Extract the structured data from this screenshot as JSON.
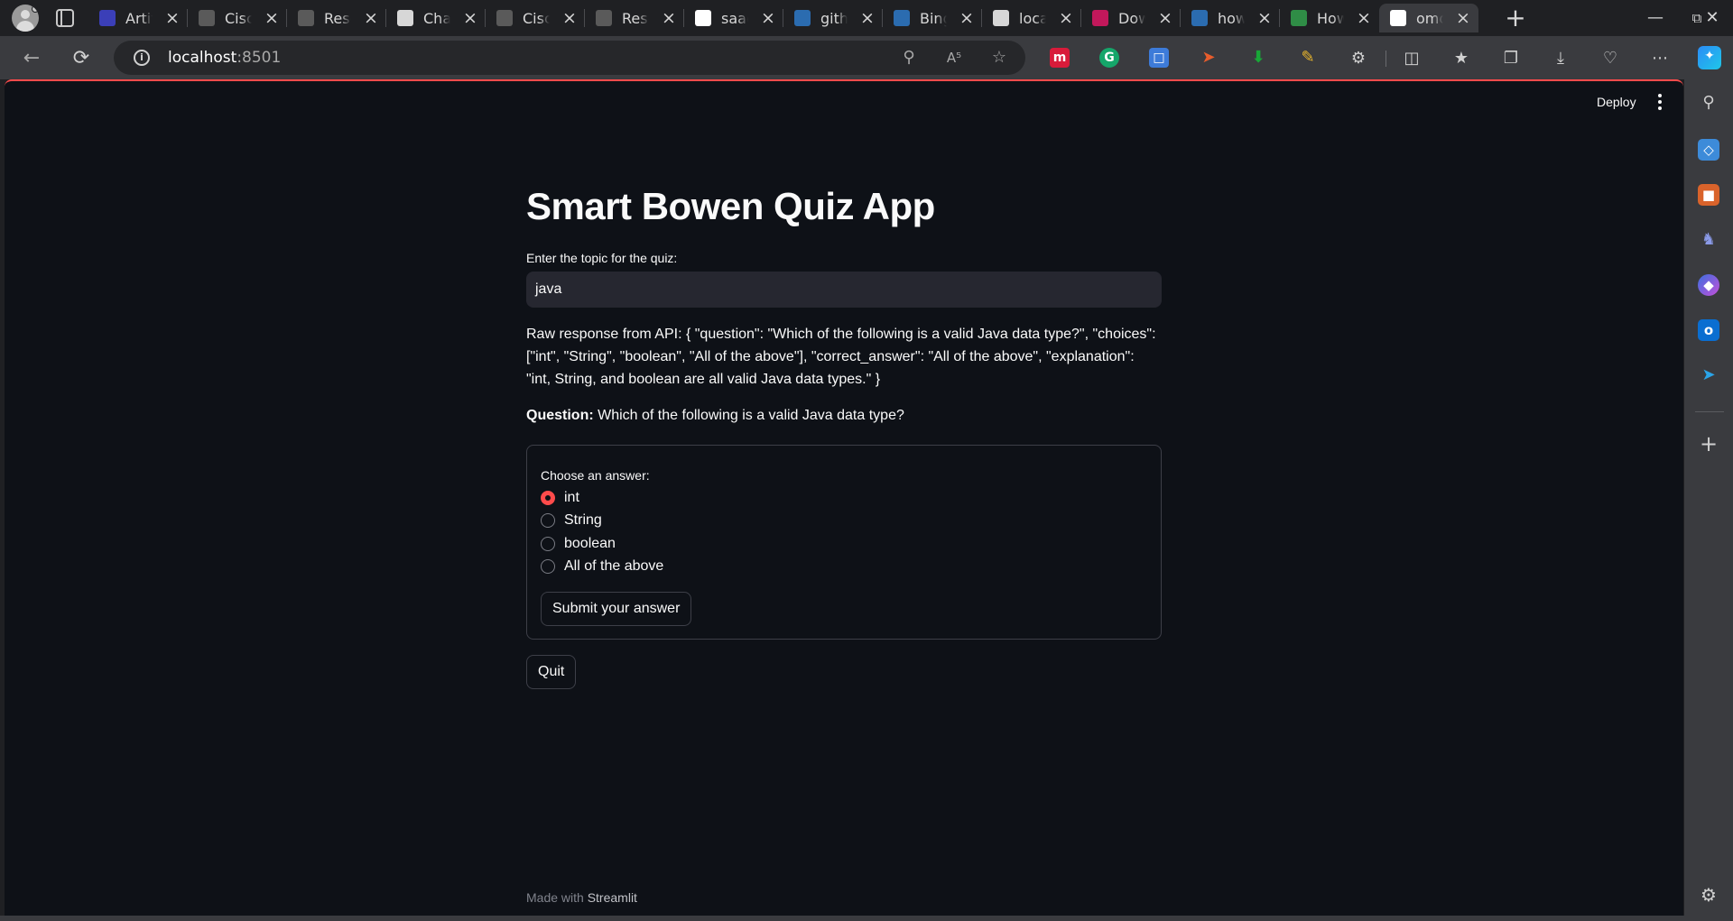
{
  "browser": {
    "tabs": [
      {
        "title": "Artifacts",
        "favicon": "artifacts-icon",
        "color": "#3b3fb8"
      },
      {
        "title": "Cisco",
        "favicon": "grid-icon",
        "color": "#5a5a5a"
      },
      {
        "title": "Resources",
        "favicon": "grid-icon",
        "color": "#5a5a5a"
      },
      {
        "title": "ChatGPT",
        "favicon": "chatgpt-icon",
        "color": "#d7d7d7"
      },
      {
        "title": "Cisco",
        "favicon": "grid-icon",
        "color": "#5a5a5a"
      },
      {
        "title": "Resources",
        "favicon": "grid-icon",
        "color": "#5a5a5a"
      },
      {
        "title": "saagar",
        "favicon": "github-icon",
        "color": "#ffffff"
      },
      {
        "title": "github",
        "favicon": "bing-search-icon",
        "color": "#2b6cb0"
      },
      {
        "title": "Bing",
        "favicon": "bing-search-icon",
        "color": "#2b6cb0"
      },
      {
        "title": "localhost",
        "favicon": "document-icon",
        "color": "#d7d7d7"
      },
      {
        "title": "Download",
        "favicon": "jetbrains-icon",
        "color": "#c2185b"
      },
      {
        "title": "how",
        "favicon": "bing-search-icon",
        "color": "#2b6cb0"
      },
      {
        "title": "How",
        "favicon": "geeks-icon",
        "color": "#2f8d46"
      },
      {
        "title": "omdb",
        "favicon": "crown-icon",
        "color": "#ffffff"
      }
    ],
    "active_tab_index": 13,
    "address": {
      "host": "localhost",
      "port": ":8501"
    }
  },
  "header": {
    "deploy_label": "Deploy"
  },
  "app": {
    "title": "Smart Bowen Quiz App",
    "topic_label": "Enter the topic for the quiz:",
    "topic_value": "java",
    "raw_response": "Raw response from API: { \"question\": \"Which of the following is a valid Java data type?\", \"choices\": [\"int\", \"String\", \"boolean\", \"All of the above\"], \"correct_answer\": \"All of the above\", \"explanation\": \"int, String, and boolean are all valid Java data types.\" }",
    "question_label": "Question:",
    "question_text": " Which of the following is a valid Java data type?",
    "form": {
      "choose_label": "Choose an answer:",
      "options": [
        "int",
        "String",
        "boolean",
        "All of the above"
      ],
      "selected_index": 0,
      "submit_label": "Submit your answer"
    },
    "quit_label": "Quit"
  },
  "footer": {
    "made_with": "Made with",
    "brand": "Streamlit"
  },
  "colors": {
    "accent": "#ff4b4b",
    "page_bg": "#0e1117",
    "input_bg": "#262730",
    "browser_chrome": "#3a3b3f"
  }
}
